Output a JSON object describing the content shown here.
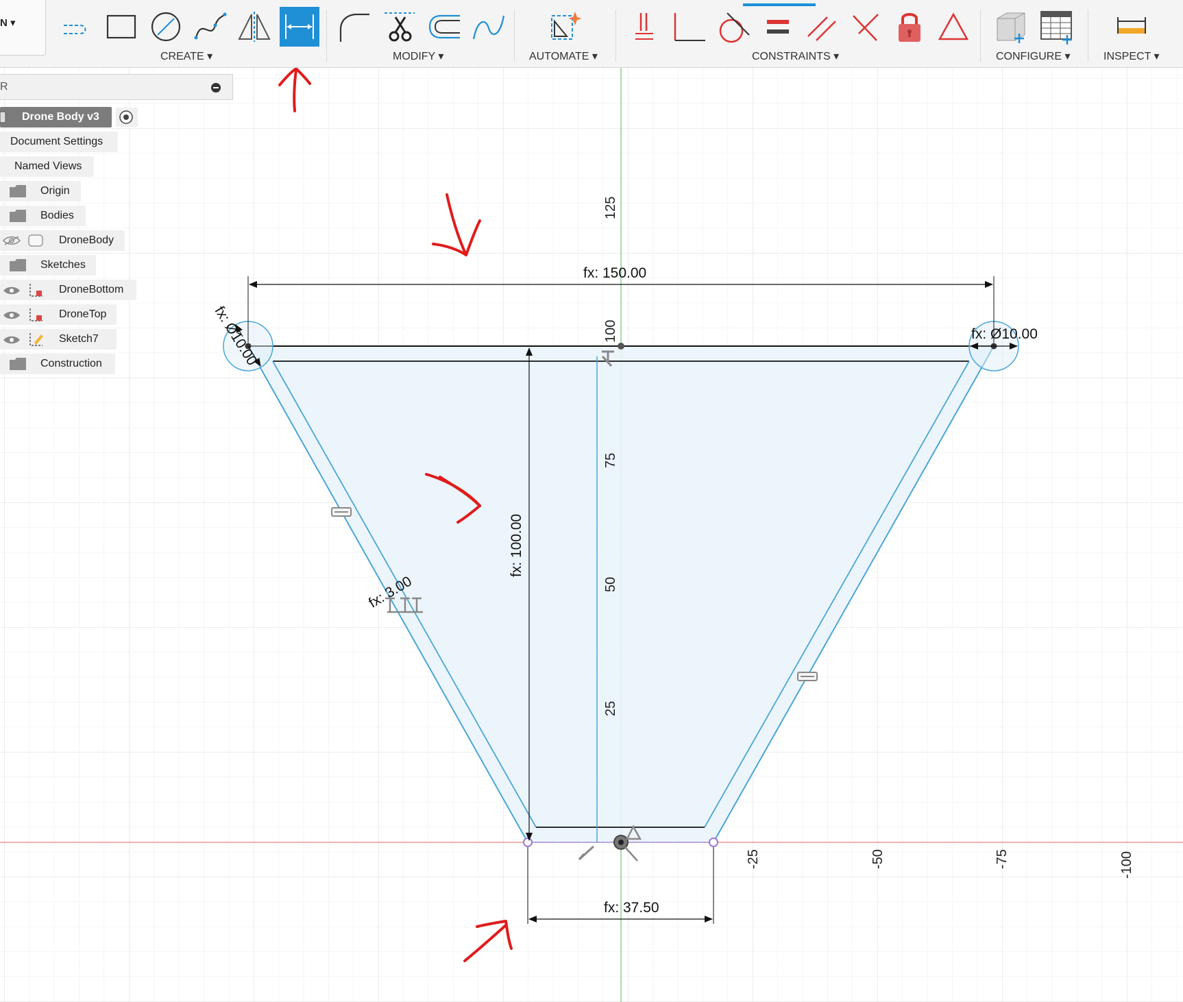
{
  "toolbar": {
    "left_label": "N ▾",
    "groups": {
      "create": "CREATE ▾",
      "modify": "MODIFY ▾",
      "automate": "AUTOMATE ▾",
      "constraints": "CONSTRAINTS ▾",
      "configure": "CONFIGURE ▾",
      "inspect": "INSPECT ▾"
    }
  },
  "browser": {
    "header": "R",
    "root": "Drone Body v3",
    "items": {
      "document_settings": "Document Settings",
      "named_views": "Named Views",
      "origin": "Origin",
      "bodies": "Bodies",
      "drone_body": "DroneBody",
      "sketches": "Sketches",
      "drone_bottom": "DroneBottom",
      "drone_top": "DroneTop",
      "sketch7": "Sketch7",
      "construction": "Construction"
    }
  },
  "sketch": {
    "dims": {
      "top_width": "fx: 150.00",
      "left_diameter": "fx: Ø10.00",
      "right_diameter": "fx: Ø10.00",
      "height": "fx: 100.00",
      "offset": "fx: 3.00",
      "bottom_width": "fx: 37.50"
    },
    "axis_vertical": [
      "125",
      "100",
      "75",
      "50",
      "25"
    ],
    "axis_horizontal": [
      "-25",
      "-50",
      "-75",
      "-100"
    ]
  },
  "colors": {
    "accent": "#1f8fd6",
    "annotation_red": "#e01b1b",
    "sketch_line": "#4aa6d6",
    "x_axis": "#e07a7a",
    "y_axis": "#5fbf5f"
  }
}
